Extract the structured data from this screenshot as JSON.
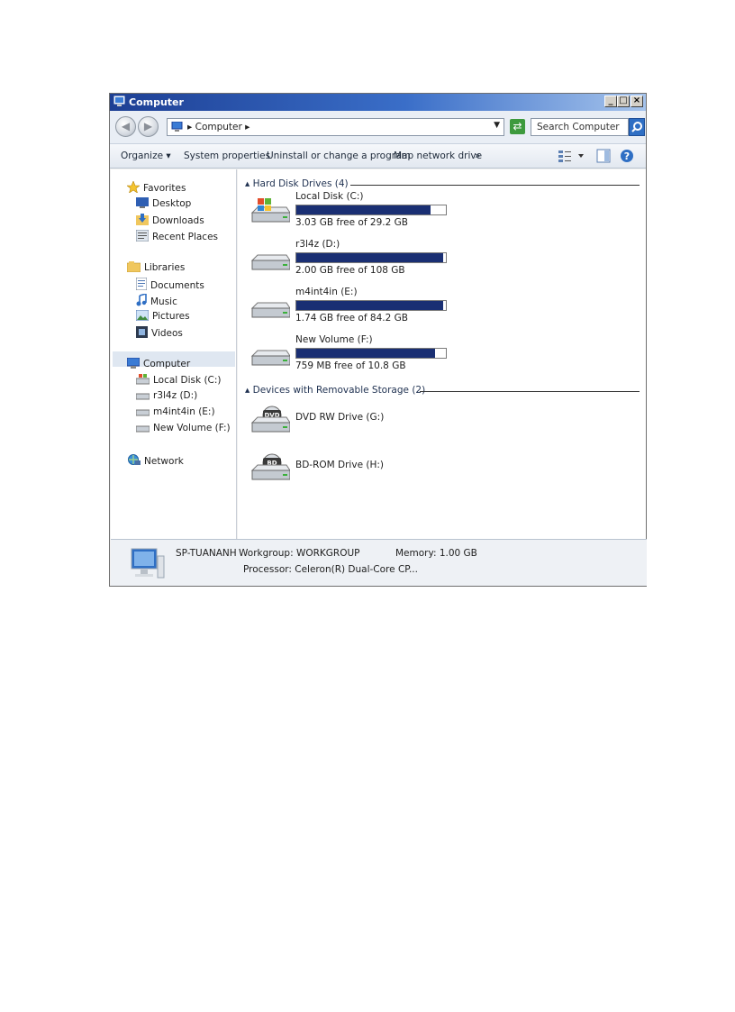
{
  "window": {
    "title": "Computer",
    "controls": {
      "minimize": "_",
      "maximize": "□",
      "close": "×"
    }
  },
  "address": {
    "back_icon": "back-arrow-icon",
    "forward_icon": "forward-arrow-icon",
    "breadcrumb": "Computer",
    "search_placeholder": "Search Computer"
  },
  "toolbar": {
    "organize": "Organize",
    "system_properties": "System properties",
    "uninstall": "Uninstall or change a program",
    "map_drive": "Map network drive",
    "more": "»"
  },
  "nav": {
    "favorites": "Favorites",
    "desktop": "Desktop",
    "downloads": "Downloads",
    "recent": "Recent Places",
    "libraries": "Libraries",
    "documents": "Documents",
    "music": "Music",
    "pictures": "Pictures",
    "videos": "Videos",
    "computer": "Computer",
    "drive_c": "Local Disk (C:)",
    "drive_d": "r3l4z (D:)",
    "drive_e": "m4int4in (E:)",
    "drive_f": "New Volume (F:)",
    "network": "Network"
  },
  "groups": {
    "hdd": "Hard Disk Drives (4)",
    "removable": "Devices with Removable Storage (2)"
  },
  "drives": [
    {
      "name": "Local Disk (C:)",
      "free": "3.03 GB free of 29.2 GB",
      "used_fraction": 0.9
    },
    {
      "name": "r3l4z (D:)",
      "free": "2.00 GB free of 108 GB",
      "used_fraction": 0.98
    },
    {
      "name": "m4int4in (E:)",
      "free": "1.74 GB free of 84.2 GB",
      "used_fraction": 0.98
    },
    {
      "name": "New Volume (F:)",
      "free": "759 MB free of 10.8 GB",
      "used_fraction": 0.93
    }
  ],
  "removable": [
    {
      "name": "DVD RW Drive (G:)",
      "badge": "DVD"
    },
    {
      "name": "BD-ROM Drive (H:)",
      "badge": "BD"
    }
  ],
  "details": {
    "computer_name": "SP-TUANANH",
    "workgroup": "Workgroup: WORKGROUP",
    "memory": "Memory: 1.00 GB",
    "processor": "Processor: Celeron(R) Dual-Core CP..."
  },
  "colors": {
    "usage_bar": "#1a2f73",
    "title_bar": "#1d3f94"
  }
}
